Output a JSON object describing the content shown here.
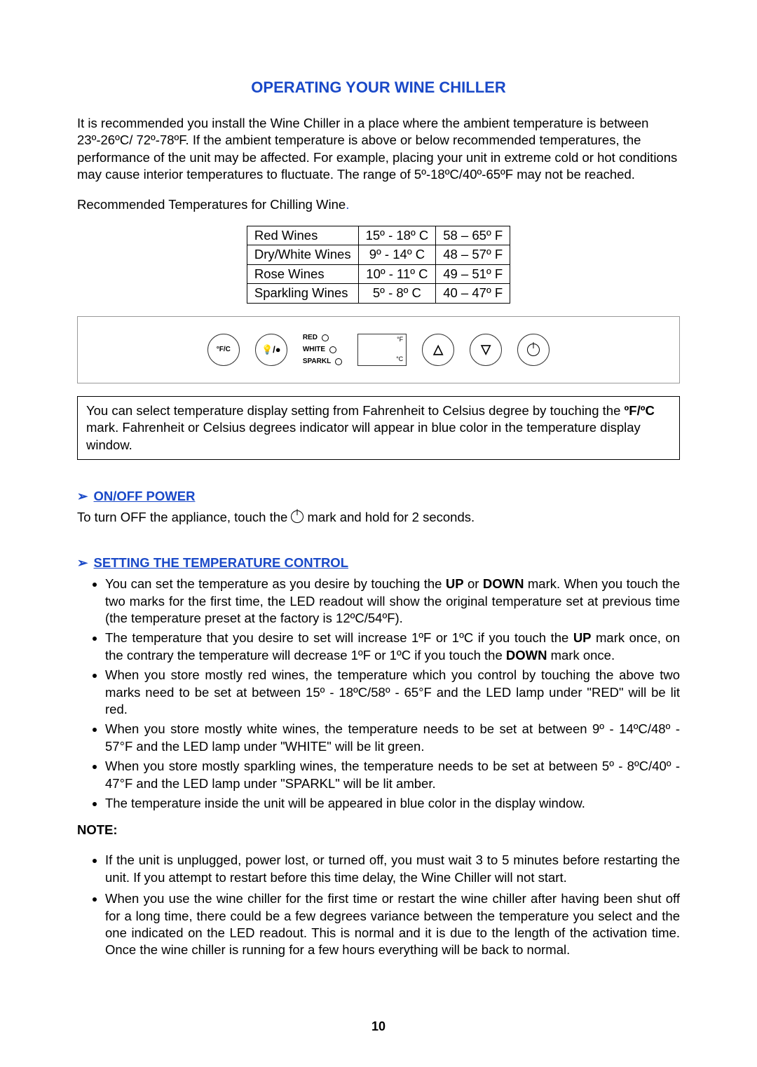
{
  "title": "OPERATING YOUR WINE CHILLER",
  "intro": "It is recommended you install the Wine Chiller in a place where the ambient temperature is between 23º-26ºC/ 72º-78ºF.  If the ambient temperature is above or below recommended temperatures, the performance of the unit may be affected.  For example, placing your unit in extreme cold or hot conditions may cause interior temperatures to fluctuate.  The range of 5º-18ºC/40º-65ºF may not be reached.",
  "rec_line_pre": "Recommended Temperatures for Chilling Wine",
  "rec_period": ".",
  "table": {
    "rows": [
      {
        "label": "Red Wines",
        "c": "15º - 18º C",
        "f": "58 – 65º F"
      },
      {
        "label": "Dry/White Wines",
        "c": "9º - 14º  C",
        "f": "48 – 57º F"
      },
      {
        "label": "Rose Wines",
        "c": "10º - 11º C",
        "f": "49 – 51º F"
      },
      {
        "label": "Sparkling Wines",
        "c": "5º - 8º  C",
        "f": "40 – 47º F"
      }
    ]
  },
  "panel": {
    "fc": "°F/C",
    "led": {
      "red": "RED",
      "white": "WHITE",
      "sparkl": "SPARKL"
    },
    "disp": {
      "f": "°F",
      "c": "°C"
    }
  },
  "box_pre": "You can select temperature display setting from Fahrenheit to Celsius degree by touching the ",
  "box_mark": "ºF/ºC",
  "box_post": " mark.  Fahrenheit or Celsius degrees indicator will appear in blue color in the temperature display window.",
  "sec1": {
    "head": "ON/OFF POWER",
    "body_pre": "To turn OFF the appliance, touch the  ",
    "body_post": "  mark and hold  for 2 seconds."
  },
  "sec2": {
    "head": "SETTING THE TEMPERATURE CONTROL",
    "b1_pre": "You can set the temperature as you desire by touching the ",
    "b1_up": "UP",
    "b1_mid": " or ",
    "b1_down": "DOWN",
    "b1_post": " mark. When you touch the two marks for the first time, the LED readout will show the original temperature set at previous time (the temperature preset at the factory is 12ºC/54ºF).",
    "b2_pre": "The temperature that you desire to set will increase 1ºF or 1ºC if you touch the ",
    "b2_up": "UP",
    "b2_mid": " mark once, on the contrary the temperature will decrease 1ºF or 1ºC if you touch the ",
    "b2_down": "DOWN",
    "b2_post": " mark once.",
    "b3": "When you store mostly red wines, the temperature which you control by touching the above two marks need to be set at between 15º - 18ºC/58º - 65°F and the LED lamp under \"RED\" will be lit red.",
    "b4": "When you store mostly white wines, the temperature needs to be set at between 9º - 14ºC/48º - 57°F and the LED lamp under \"WHITE\" will be lit green.",
    "b5": "When you store mostly sparkling wines, the temperature needs to be set at between 5º - 8ºC/40º - 47°F and the LED lamp under \"SPARKL\" will be lit amber.",
    "b6": "The temperature inside the unit will be appeared in blue color in the display window."
  },
  "note": {
    "head": "NOTE:",
    "n1": "If the unit is unplugged, power lost, or turned off, you must wait 3 to 5 minutes before restarting the unit. If you attempt to restart before this time delay, the Wine Chiller will not start.",
    "n2": "When you use the wine chiller for the first time or restart the wine chiller after having been shut off for a long time, there could be a few degrees variance between the temperature you select and the one indicated on the LED readout.  This is normal and it is due to the length of the activation time. Once the wine chiller is running for a few hours everything will be back to normal."
  },
  "page_number": "10"
}
